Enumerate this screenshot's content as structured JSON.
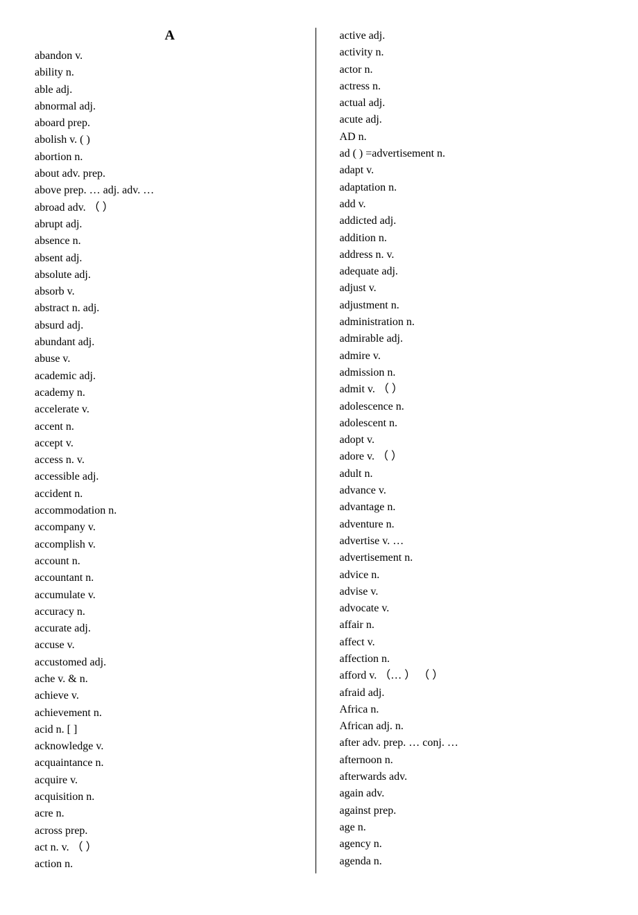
{
  "heading": "A",
  "left": [
    "abandon v.",
    "ability n.",
    "able adj.",
    "abnormal adj.",
    "aboard prep.",
    "abolish v.           (     )",
    "abortion n.",
    "about adv.               prep.",
    "above prep.    …     adj.         adv.    …",
    "abroad adv.    （  ）",
    "abrupt adj.",
    "absence n.",
    "absent adj.",
    "absolute adj.",
    "absorb v.",
    "abstract n.                  adj.",
    "absurd adj.",
    "abundant adj.",
    "abuse v.",
    "academic adj.",
    "academy n.",
    "accelerate v.",
    "accent n.",
    "accept v.",
    "access n.             v.",
    "accessible adj.",
    "accident n.",
    "accommodation n.",
    "accompany v.",
    "accomplish v.",
    "account n.",
    "accountant n.",
    "accumulate v.",
    "accuracy n.",
    "accurate adj.",
    "accuse v.",
    "accustomed adj.",
    "ache v. & n.",
    "achieve v.",
    "achievement n.",
    "acid n. [ ]",
    "acknowledge v.",
    "acquaintance n.",
    "acquire v.",
    "acquisition n.",
    "acre n.",
    "across prep.",
    "act n.           v.             （    ）",
    "action n."
  ],
  "right": [
    "active adj.",
    "activity n.",
    "actor n.",
    "actress n.",
    "actual adj.",
    "acute adj.",
    "AD n.",
    "ad ( ) =advertisement n.",
    "adapt v.",
    "adaptation n.",
    "add v.",
    "addicted adj.",
    "addition n.",
    "address n.       v.",
    "adequate adj.",
    "adjust v.",
    "adjustment n.",
    "administration n.",
    "admirable adj.",
    "admire v.",
    "admission n.",
    "admit v.              （           ）",
    "adolescence n.",
    "adolescent n.",
    "adopt v.",
    "adore v.              （    ）",
    "adult n.",
    "advance v.",
    "advantage n.",
    "adventure n.",
    "advertise v.    …",
    "advertisement n.",
    "advice n.",
    "advise v.",
    "advocate v.",
    "affair n.",
    "affect v.",
    "affection n.",
    "afford v.         （…      ）            （    ）",
    "afraid adj.",
    "Africa n.",
    "African adj.                  n.",
    "after adv.              prep.    …               conj.    …",
    "afternoon n.",
    "afterwards adv.",
    "again adv.",
    "against prep.",
    "age n.",
    "agency n.",
    "agenda n."
  ]
}
